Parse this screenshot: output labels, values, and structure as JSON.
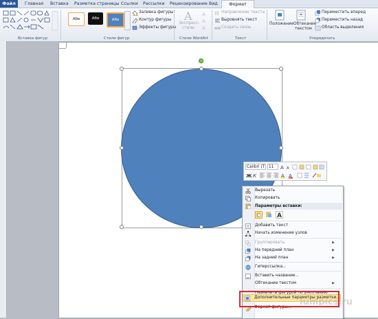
{
  "tabs": {
    "file": "Файл",
    "items": [
      "Главная",
      "Вставка",
      "Разметка страницы",
      "Ссылки",
      "Рассылки",
      "Рецензирование",
      "Вид"
    ],
    "format": "Формат"
  },
  "ribbon": {
    "insert_shapes_label": "Вставка фигур",
    "shape_styles_label": "Стили фигур",
    "style_swatch_text": "Абв",
    "fill": "Заливка фигуры",
    "outline": "Контур фигуры",
    "effects": "Эффекты фигуры",
    "express_styles": [
      "Экспресс-",
      "стили"
    ],
    "wordart_label": "Стили WordArt",
    "text_direction": "Направление текста",
    "align_text": "Выровнять текст",
    "create_link": "Создать связь",
    "text_label": "Текст",
    "position": "Положение",
    "wrap_text": [
      "Обтекание",
      "текстом"
    ],
    "bring_forward": "Переместить вперед",
    "send_backward": "Переместить назад",
    "selection_pane": "Область выделения",
    "arrange_label": "Упорядочить"
  },
  "mini_toolbar": {
    "font": "Calibri (Т",
    "size": "11"
  },
  "context_menu": {
    "cut": "Вырезать",
    "copy": "Копировать",
    "paste_options": "Параметры вставки:",
    "add_text": "Добавить текст",
    "edit_points": "Начать изменение узлов",
    "group": "Группировать",
    "bring_front": "На передний план",
    "send_back": "На задний план",
    "hyperlink": "Гиперссылка...",
    "insert_caption": "Вставить название...",
    "wrap_text": "Обтекание текстом",
    "set_default": "Назначить фигурой по умолчанию",
    "more_layout": "Дополнительные параметры разметки...",
    "format_shape": "Формат фигуры..."
  },
  "watermark": "lumpics.ru",
  "colors": {
    "shape_fill": "#4f81bd",
    "highlight_border": "#d9262c",
    "file_tab": "#2a5699"
  }
}
